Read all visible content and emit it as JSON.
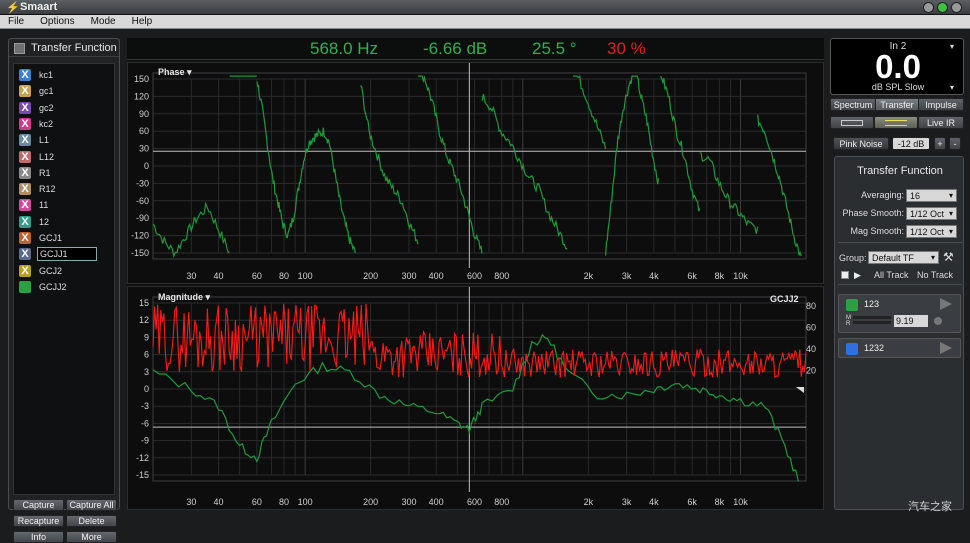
{
  "app": {
    "title": "Smaart"
  },
  "menu": [
    "File",
    "Options",
    "Mode",
    "Help"
  ],
  "colors": {
    "accent_green": "#2db34a",
    "readout_red": "#e02020",
    "trace_green": "#1f9a3a",
    "trace_red": "#ff1a1a"
  },
  "left_panel": {
    "title": "Transfer Function",
    "tracks": [
      {
        "label": "kc1",
        "color": "#3a7fd0"
      },
      {
        "label": "gc1",
        "color": "#c8a050"
      },
      {
        "label": "gc2",
        "color": "#7a4ab0"
      },
      {
        "label": "kc2",
        "color": "#d03a8c"
      },
      {
        "label": "L1",
        "color": "#6a8aa0"
      },
      {
        "label": "L12",
        "color": "#c06a6a"
      },
      {
        "label": "R1",
        "color": "#8a8a8a"
      },
      {
        "label": "R12",
        "color": "#b09060"
      },
      {
        "label": "11",
        "color": "#d04aa0"
      },
      {
        "label": "12",
        "color": "#2e9e8a"
      },
      {
        "label": "GCJ1",
        "color": "#c0602a"
      },
      {
        "label": "GCJJ1",
        "color": "#5a6a8a"
      },
      {
        "label": "GCJ2",
        "color": "#b8a020"
      },
      {
        "label": "GCJJ2",
        "color": "#2aa040"
      }
    ],
    "buttons": [
      "Capture",
      "Capture All",
      "Recapture",
      "Delete",
      "Info",
      "More"
    ]
  },
  "readout": {
    "freq": "568.0 Hz",
    "db": "-6.66 dB",
    "phase": "25.5 °",
    "coherence": "30 %"
  },
  "phase_plot": {
    "label": "Phase ▾",
    "y_ticks": [
      "150",
      "120",
      "90",
      "60",
      "30",
      "0",
      "-30",
      "-60",
      "-90",
      "-120",
      "-150"
    ],
    "x_ticks": [
      "30",
      "40",
      "60",
      "80",
      "100",
      "200",
      "300",
      "400",
      "600",
      "800",
      "2k",
      "3k",
      "4k",
      "6k",
      "8k",
      "10k"
    ]
  },
  "magnitude_plot": {
    "label": "Magnitude ▾",
    "trace_name": "GCJJ2",
    "y_ticks": [
      "15",
      "12",
      "9",
      "6",
      "3",
      "0",
      "-3",
      "-6",
      "-9",
      "-12",
      "-15"
    ],
    "y_right_ticks": [
      "80",
      "60",
      "40",
      "20"
    ],
    "x_ticks": [
      "30",
      "40",
      "60",
      "80",
      "100",
      "200",
      "300",
      "400",
      "600",
      "800",
      "2k",
      "3k",
      "4k",
      "6k",
      "8k",
      "10k"
    ]
  },
  "meter": {
    "channel": "In 2",
    "value": "0.0",
    "mode": "dB SPL Slow"
  },
  "mode_tabs": [
    "Spectrum",
    "Transfer",
    "Impulse"
  ],
  "live_ir": "Live IR",
  "generator": {
    "label": "Pink Noise",
    "level": "-12 dB",
    "plus": "+",
    "minus": "-"
  },
  "tf_panel": {
    "title": "Transfer Function",
    "averaging_label": "Averaging:",
    "averaging_value": "16",
    "phase_smooth_label": "Phase Smooth:",
    "phase_smooth_value": "1/12 Oct",
    "mag_smooth_label": "Mag Smooth:",
    "mag_smooth_value": "1/12 Oct",
    "group_label": "Group:",
    "group_value": "Default TF",
    "all_track": "All Track",
    "no_track": "No Track"
  },
  "tracks_panel": [
    {
      "name": "123",
      "color": "#2aa040",
      "delay": "9.19"
    },
    {
      "name": "1232",
      "color": "#2f6fe0"
    }
  ],
  "watermark": "汽车之家"
}
